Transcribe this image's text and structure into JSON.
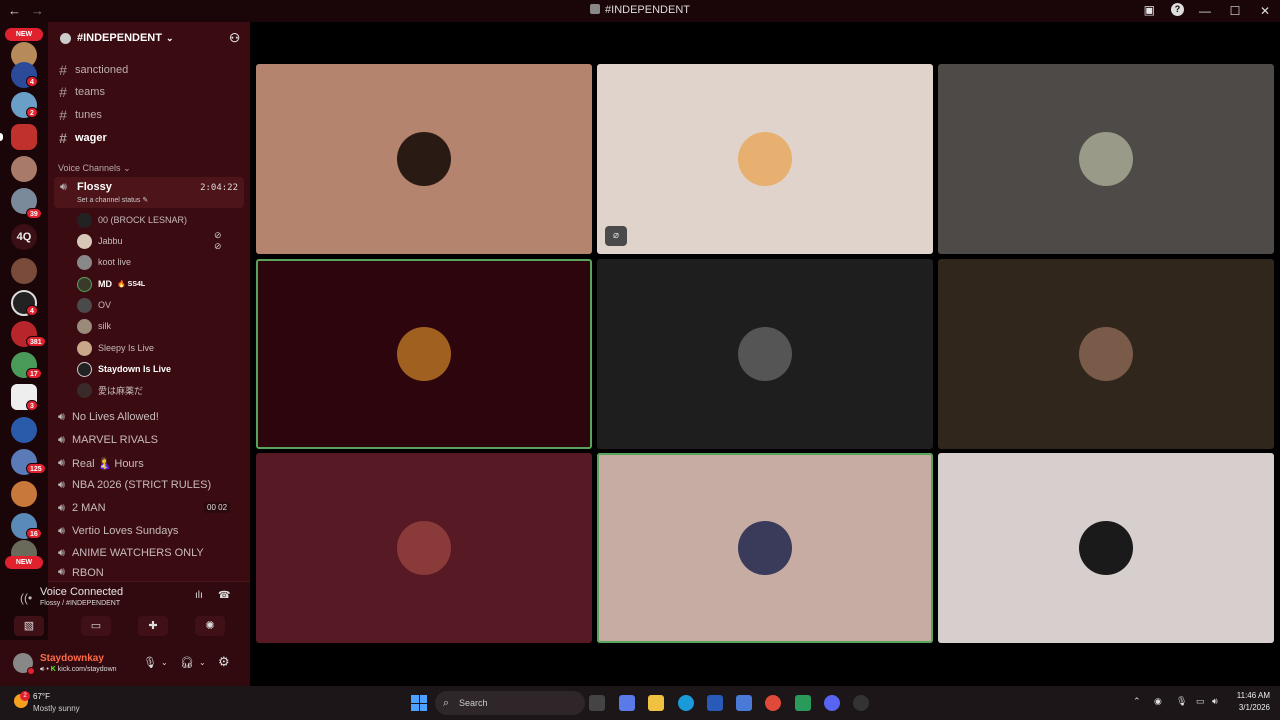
{
  "window": {
    "title": "#INDEPENDENT",
    "back_icon": "←",
    "forward_icon": "→",
    "minimize": "—",
    "maximize": "☐",
    "close": "✕",
    "screen_icon": "▣",
    "help_icon": "?"
  },
  "rail": {
    "new_top": "NEW",
    "new_bottom": "NEW",
    "text_server": "4Q",
    "badges": [
      "4",
      "2",
      "39",
      "4",
      "3",
      "381",
      "17",
      "3",
      "125",
      "16"
    ]
  },
  "sidebar": {
    "server_name": "#INDEPENDENT",
    "text_channels": [
      "sanctioned",
      "teams",
      "tunes",
      "wager"
    ],
    "voice_category": "Voice Channels",
    "active_voice": {
      "name": "Flossy",
      "time": "2:04:22",
      "status": "Set a channel status"
    },
    "members": [
      {
        "name": "00 (BROCK LESNAR)"
      },
      {
        "name": "Jabbu"
      },
      {
        "name": "koot live"
      },
      {
        "name": "MD",
        "tag": "SS4L"
      },
      {
        "name": "OV"
      },
      {
        "name": "silk"
      },
      {
        "name": "Sleepy Is Live"
      },
      {
        "name": "Staydown Is Live"
      },
      {
        "name": "愛は麻薬だ"
      }
    ],
    "voice_channels": [
      {
        "name": "No Lives Allowed!"
      },
      {
        "name": "MARVEL RIVALS"
      },
      {
        "name": "Real 🤱 Hours"
      },
      {
        "name": "NBA 2026 (STRICT RULES)"
      },
      {
        "name": "2 MAN",
        "pill": "00  02"
      },
      {
        "name": "Vertio Loves Sundays"
      },
      {
        "name": "ANIME WATCHERS ONLY"
      },
      {
        "name": "RBON"
      }
    ]
  },
  "voice_connection": {
    "status": "Voice Connected",
    "location": "Flossy / #INDEPENDENT"
  },
  "user": {
    "name": "Staydownkay",
    "status": "kick.com/staydown"
  },
  "taskbar": {
    "weather_badge": "2",
    "temperature": "67°F",
    "condition": "Mostly sunny",
    "search_placeholder": "Search",
    "time": "11:46 AM",
    "date": "3/1/2026"
  },
  "colors": {
    "accent_red": "#e0222e",
    "speaking_outline": "#5aa35a",
    "sidebar_bg": "#3a0b10"
  }
}
